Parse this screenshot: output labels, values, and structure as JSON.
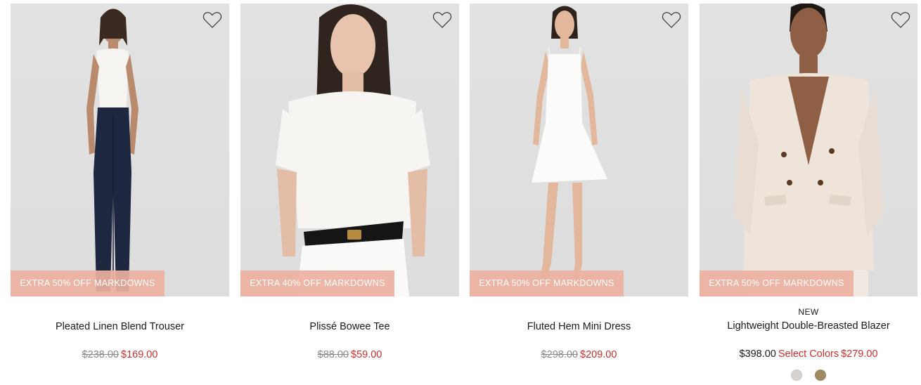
{
  "products": [
    {
      "promo": "EXTRA 50% OFF MARKDOWNS",
      "badge": "",
      "name": "Pleated Linen Blend Trouser",
      "was_price": "$238.00",
      "sale_price": "$169.00"
    },
    {
      "promo": "EXTRA 40% OFF MARKDOWNS",
      "badge": "",
      "name": "Plissé Bowee Tee",
      "was_price": "$88.00",
      "sale_price": "$59.00"
    },
    {
      "promo": "EXTRA 50% OFF MARKDOWNS",
      "badge": "",
      "name": "Fluted Hem Mini Dress",
      "was_price": "$298.00",
      "sale_price": "$209.00"
    },
    {
      "promo": "EXTRA 50% OFF MARKDOWNS",
      "badge": "NEW",
      "name": "Lightweight Double-Breasted Blazer",
      "regular_price": "$398.00",
      "select_label": "Select Colors",
      "sale_price": "$279.00",
      "swatches": [
        "#d6d3cf",
        "#a08b62"
      ]
    }
  ],
  "icons": {
    "wishlist": "heart-outline-icon"
  },
  "colors": {
    "sale": "#c8312f",
    "promo_bg": "#ecb0a0",
    "was": "#8a8a8a"
  }
}
